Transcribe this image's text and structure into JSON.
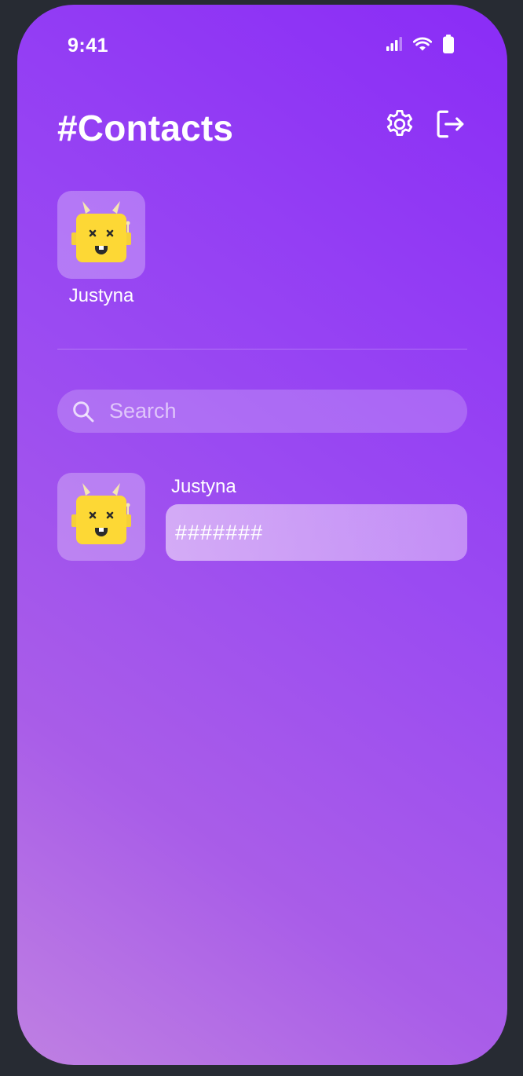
{
  "status_bar": {
    "time": "9:41"
  },
  "header": {
    "title": "#Contacts",
    "settings_icon": "gear-icon",
    "logout_icon": "logout-icon"
  },
  "favorites": [
    {
      "name": "Justyna",
      "avatar": "yellow-robot-avatar"
    }
  ],
  "search": {
    "placeholder": "Search",
    "value": ""
  },
  "contacts": [
    {
      "name": "Justyna",
      "code": "#######",
      "avatar": "yellow-robot-avatar"
    }
  ],
  "colors": {
    "background_gradient": [
      "#8a2cf6",
      "#bf80e2"
    ],
    "frame": "#272b33",
    "avatar_yellow": "#fdd835",
    "text": "#ffffff"
  }
}
